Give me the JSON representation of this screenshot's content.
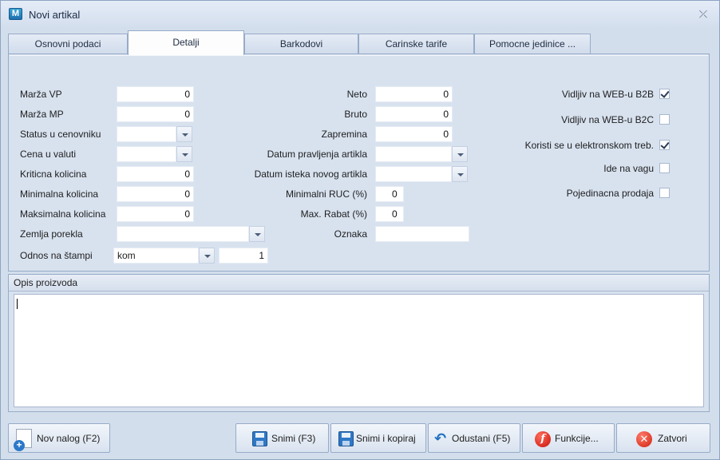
{
  "window": {
    "title": "Novi artikal",
    "app_icon_letter": "M"
  },
  "tabs": [
    {
      "label": "Osnovni podaci"
    },
    {
      "label": "Detalji"
    },
    {
      "label": "Barkodovi"
    },
    {
      "label": "Carinske tarife"
    },
    {
      "label": "Pomocne jedinice ..."
    }
  ],
  "active_tab": "Detalji",
  "left_fields": {
    "marza_vp": {
      "label": "Marža VP",
      "value": "0"
    },
    "marza_mp": {
      "label": "Marža MP",
      "value": "0"
    },
    "status_cenovnik": {
      "label": "Status u cenovniku",
      "value": ""
    },
    "cena_valuti": {
      "label": "Cena u valuti",
      "value": ""
    },
    "kriticna": {
      "label": "Kriticna kolicina",
      "value": "0"
    },
    "minimalna": {
      "label": "Minimalna kolicina",
      "value": "0"
    },
    "maksimalna": {
      "label": "Maksimalna kolicina",
      "value": "0"
    },
    "zemlja": {
      "label": "Zemlja porekla",
      "value": ""
    },
    "odnos": {
      "label": "Odnos na štampi",
      "unit": "kom",
      "value": "1"
    }
  },
  "mid_fields": {
    "neto": {
      "label": "Neto",
      "value": "0"
    },
    "bruto": {
      "label": "Bruto",
      "value": "0"
    },
    "zapremina": {
      "label": "Zapremina",
      "value": "0"
    },
    "datum_pravljenja": {
      "label": "Datum pravljenja artikla",
      "value": ""
    },
    "datum_isteka": {
      "label": "Datum isteka novog artikla",
      "value": ""
    },
    "min_ruc": {
      "label": "Minimalni RUC (%)",
      "value": "0"
    },
    "max_rabat": {
      "label": "Max. Rabat (%)",
      "value": "0"
    },
    "oznaka": {
      "label": "Oznaka",
      "value": ""
    }
  },
  "checkboxes": [
    {
      "label": "Vidljiv na WEB-u B2B",
      "checked": true
    },
    {
      "label": "Vidljiv na WEB-u B2C",
      "checked": false
    },
    {
      "label": "Koristi se u elektronskom treb.",
      "checked": true
    },
    {
      "label": "Ide na vagu",
      "checked": false
    },
    {
      "label": "Pojedinacna prodaja",
      "checked": false
    }
  ],
  "opis": {
    "title": "Opis proizvoda",
    "value": ""
  },
  "buttons": {
    "nov_nalog": "Nov nalog (F2)",
    "snimi": "Snimi (F3)",
    "snimi_kopiraj": "Snimi i kopiraj",
    "odustani": "Odustani (F5)",
    "funkcije": "Funkcije...",
    "zatvori": "Zatvori"
  },
  "icons": {
    "close": "close-icon",
    "save": "floppy-icon",
    "undo": "undo-icon",
    "functions": "function-icon",
    "exit": "close-circle-icon",
    "new": "new-document-icon"
  }
}
